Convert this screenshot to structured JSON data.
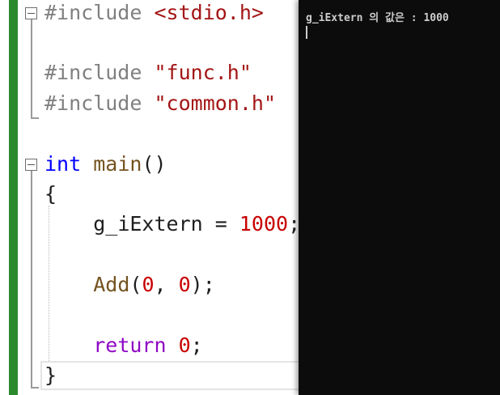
{
  "editor": {
    "lines": {
      "include_stdio": {
        "directive": "#include",
        "header": "<stdio.h>"
      },
      "include_func": {
        "directive": "#include",
        "header": "\"func.h\""
      },
      "include_common": {
        "directive": "#include",
        "header": "\"common.h\""
      },
      "main_sig": {
        "type": "int",
        "name": "main",
        "parens": "()"
      },
      "open_brace": "{",
      "assign": {
        "var": "g_iExtern",
        "op": " = ",
        "value": "1000",
        "end": ";"
      },
      "call": {
        "fn": "Add",
        "open": "(",
        "arg1": "0",
        "sep": ", ",
        "arg2": "0",
        "close": ");"
      },
      "ret": {
        "kw": "return",
        "value": "0",
        "end": ";"
      },
      "close_brace": "}"
    }
  },
  "console": {
    "output": "g_iExtern 의 값은 : 1000"
  },
  "colors": {
    "keyword": "#0000ff",
    "string": "#a31515",
    "control": "#8f08c4",
    "function": "#74531f",
    "number": "#c80000",
    "change_bar": "#2d8a2d",
    "console_bg": "#0c0c0c"
  }
}
